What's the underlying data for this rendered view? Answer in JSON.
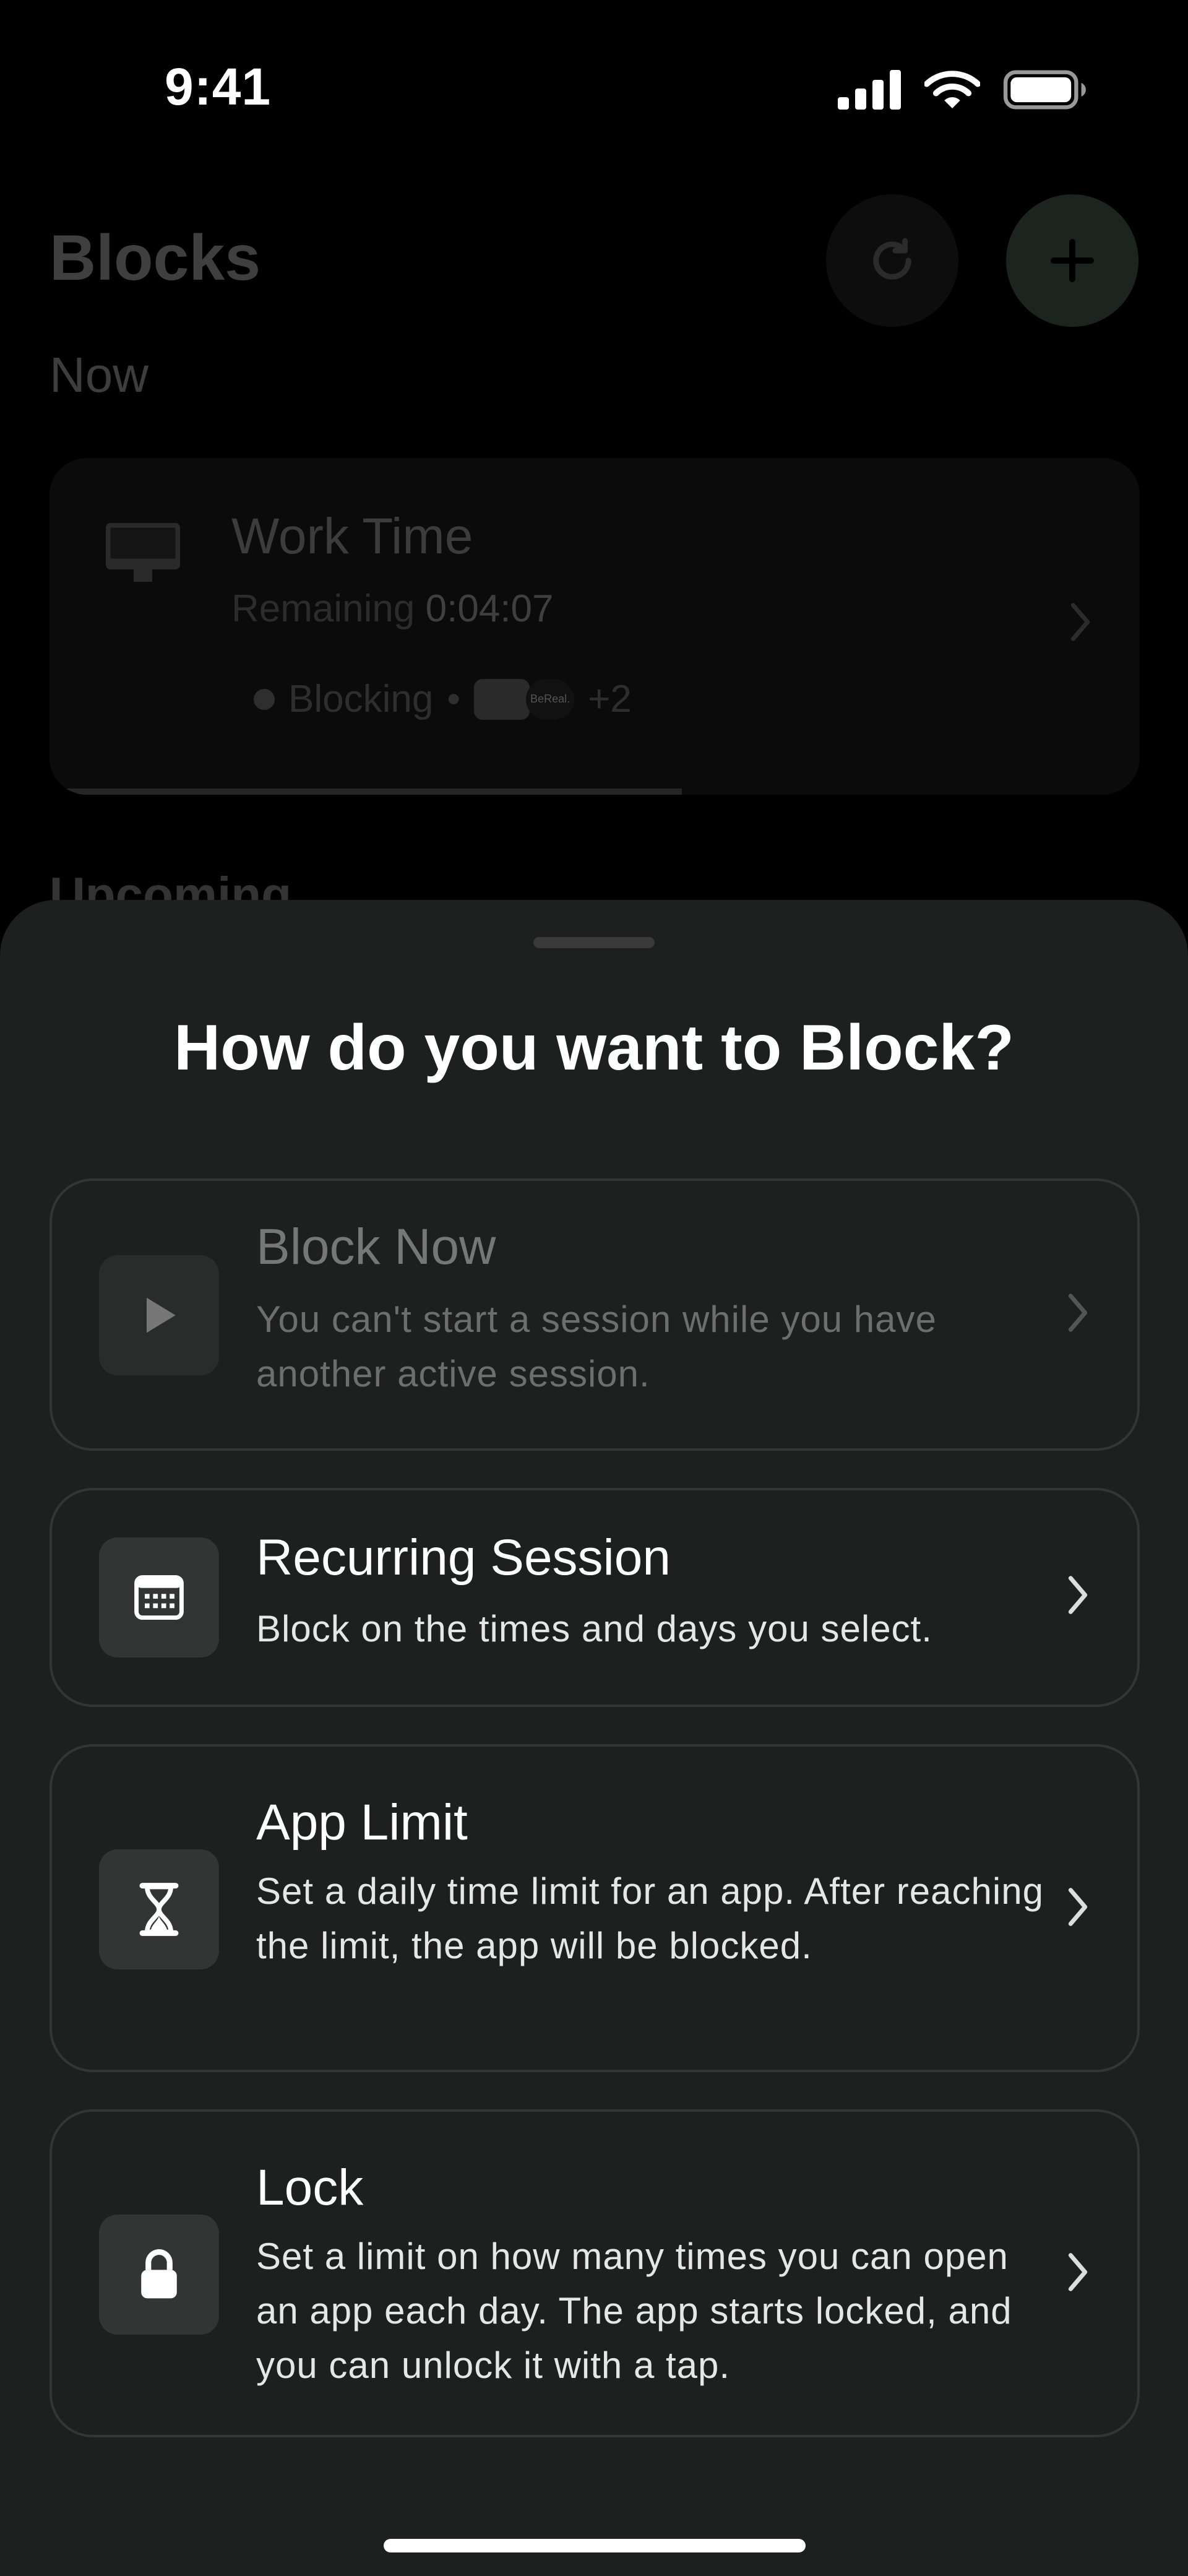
{
  "status_bar": {
    "time": "9:41",
    "icons": [
      "cellular-signal-icon",
      "wifi-icon",
      "battery-icon"
    ]
  },
  "background": {
    "title": "Blocks",
    "icons": [
      "refresh-icon",
      "plus-icon"
    ],
    "now_label": "Now",
    "upcoming_label": "Upcoming",
    "session": {
      "name": "Work Time",
      "remaining_label": "Remaining",
      "remaining_value": "0:04:07",
      "status": "Blocking",
      "separator": "•",
      "app_thumb_label": "BeReal.",
      "extra_apps": "+2",
      "progress": 0.58
    }
  },
  "sheet": {
    "title": "How do you want to Block?",
    "options": [
      {
        "title": "Block Now",
        "description": "You can't start a session while you have another active session.",
        "icon": "play-icon",
        "disabled": true
      },
      {
        "title": "Recurring Session",
        "description": "Block on the times and days you select.",
        "icon": "calendar-icon",
        "disabled": false
      },
      {
        "title": "App Limit",
        "description": "Set a daily time limit for an app. After reaching the limit, the app will be blocked.",
        "icon": "hourglass-icon",
        "disabled": false
      },
      {
        "title": "Lock",
        "description": "Set a limit on how many times you can open an app each day. The app starts locked, and you can unlock it with a tap.",
        "icon": "lock-icon",
        "disabled": false
      }
    ]
  },
  "colors": {
    "sheet_background": "#1e1f1f",
    "card_border": "#343535",
    "icon_box": "#333434",
    "text_primary": "#ffffff",
    "text_disabled": "#777777"
  }
}
